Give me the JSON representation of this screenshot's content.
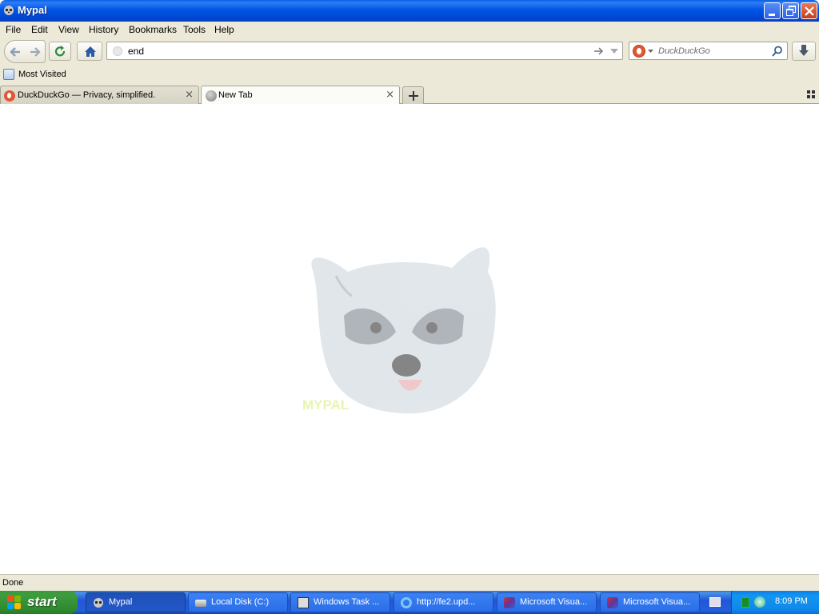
{
  "window": {
    "title": "Mypal"
  },
  "menu": [
    "File",
    "Edit",
    "View",
    "History",
    "Bookmarks",
    "Tools",
    "Help"
  ],
  "nav": {
    "url_value": "end",
    "search_placeholder": "DuckDuckGo"
  },
  "bookmarks": {
    "most_visited": "Most Visited"
  },
  "tabs": [
    {
      "label": "DuckDuckGo — Privacy, simplified.",
      "active": false
    },
    {
      "label": "New Tab",
      "active": true
    }
  ],
  "content": {
    "logo_text": "MYPAL"
  },
  "status": {
    "text": "Done"
  },
  "taskbar": {
    "start_label": "start",
    "tasks": [
      {
        "label": "Mypal",
        "active": true
      },
      {
        "label": "Local Disk (C:)"
      },
      {
        "label": "Windows Task ..."
      },
      {
        "label": "http://fe2.upd..."
      },
      {
        "label": "Microsoft Visua..."
      },
      {
        "label": "Microsoft Visua..."
      }
    ],
    "clock": "8:09 PM"
  },
  "colors": {
    "titlebar": "#0055e5",
    "chrome": "#ece9d8",
    "taskbar": "#245edb",
    "start": "#3c9a3c"
  }
}
